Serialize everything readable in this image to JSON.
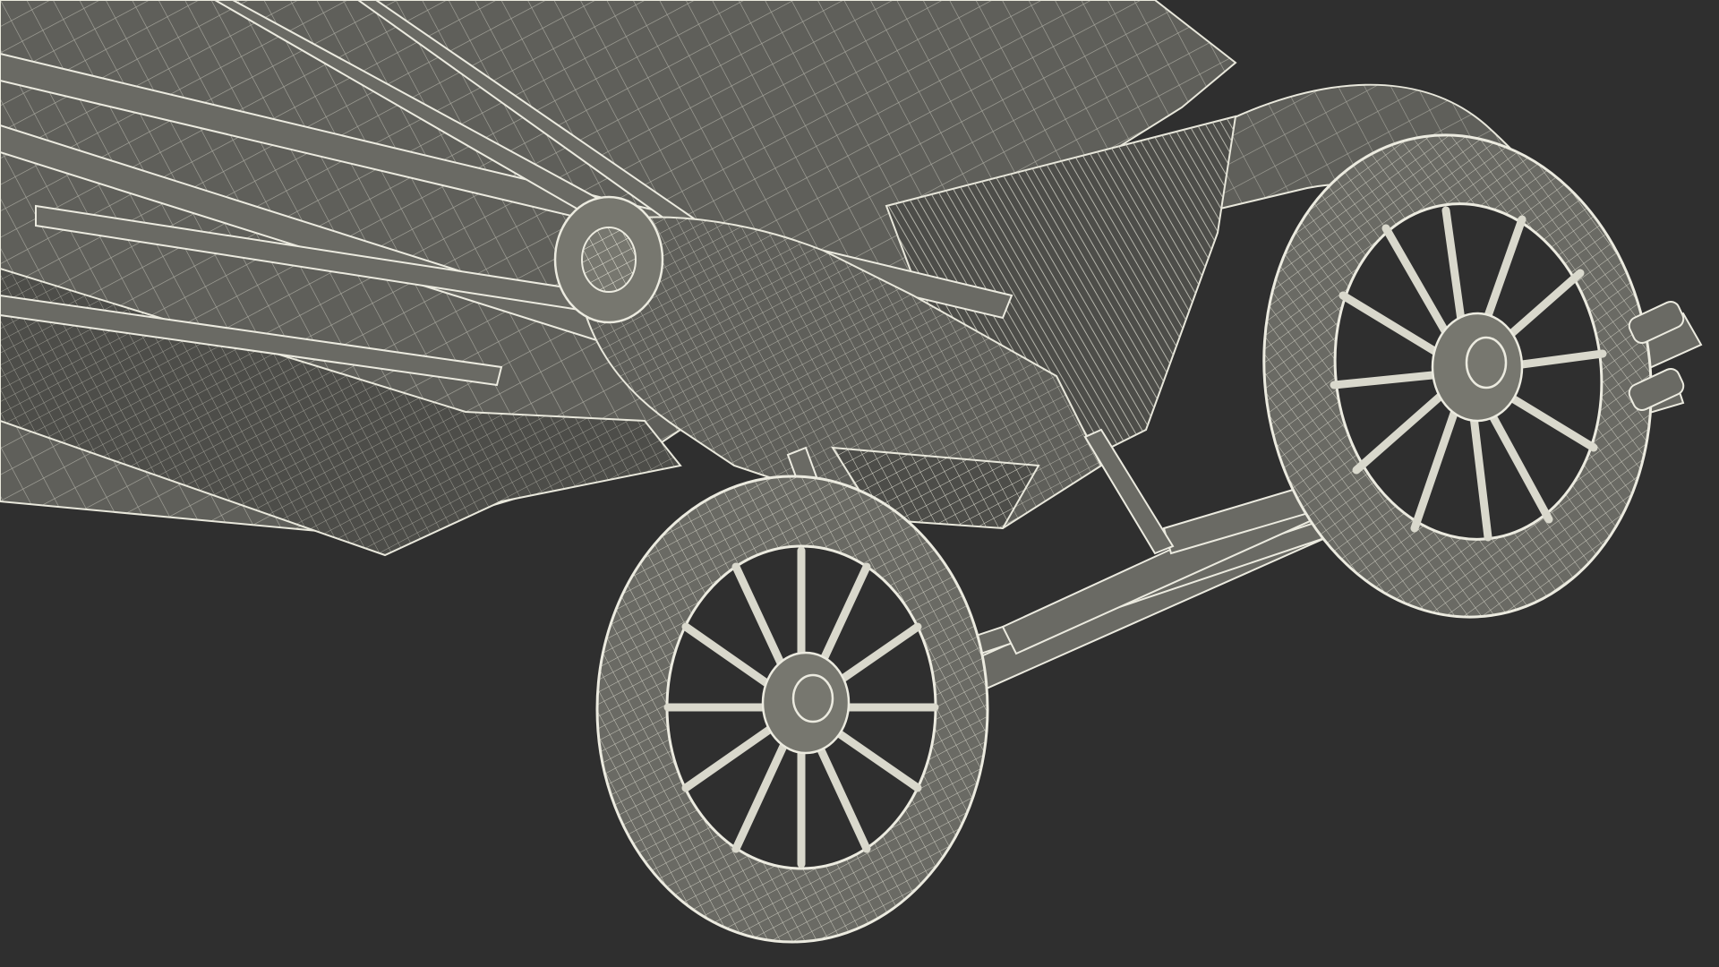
{
  "scene": {
    "subject": "wireframe-car-underside",
    "background_color": "#2f2f2f",
    "wire_color": "#ecebe0",
    "surface_color": "#5f5f5a",
    "wheel_count": 2,
    "spokes_per_wheel": 12
  }
}
